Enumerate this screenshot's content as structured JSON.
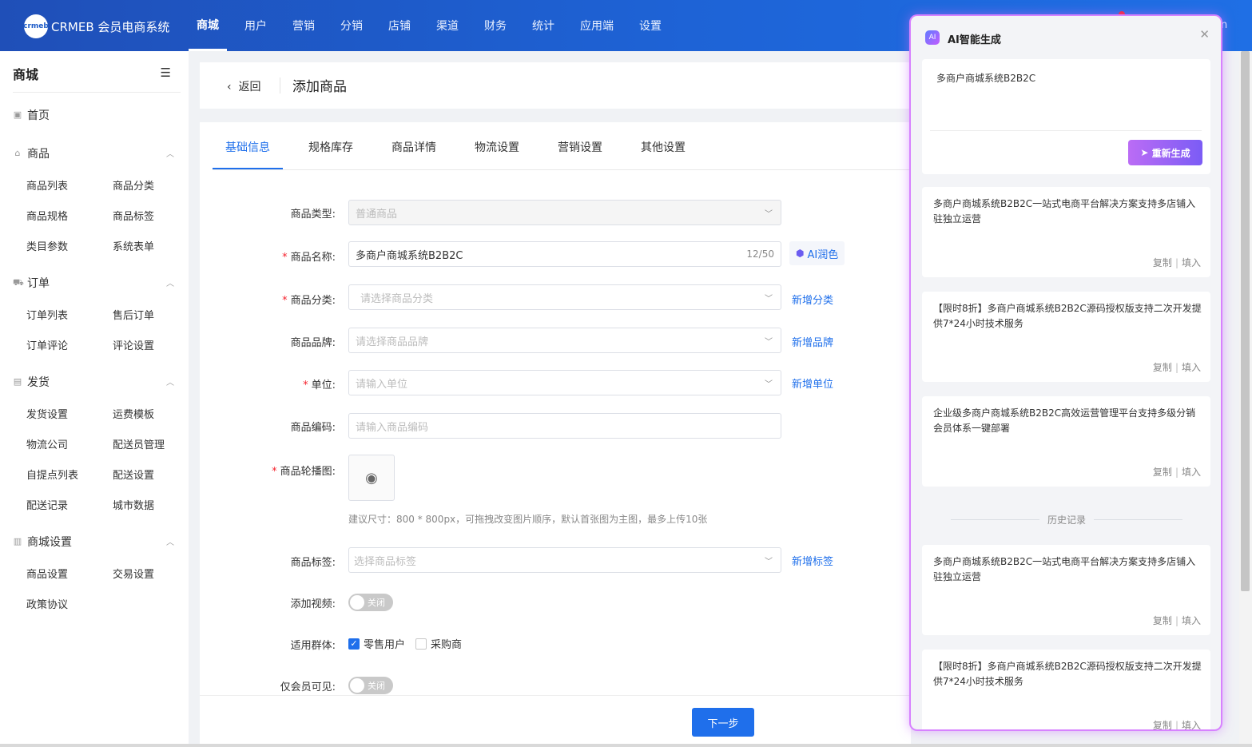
{
  "brand": {
    "logo_badge": "crmeb",
    "name": "CRMEB 会员电商系统"
  },
  "topnav": [
    "商城",
    "用户",
    "营销",
    "分销",
    "店铺",
    "渠道",
    "财务",
    "统计",
    "应用端",
    "设置"
  ],
  "topbar_user": "n",
  "sidebar": {
    "title": "商城",
    "home": "首页",
    "sections": [
      {
        "label": "商品",
        "items": [
          "商品列表",
          "商品分类",
          "商品规格",
          "商品标签",
          "类目参数",
          "系统表单"
        ]
      },
      {
        "label": "订单",
        "items": [
          "订单列表",
          "售后订单",
          "订单评论",
          "评论设置"
        ]
      },
      {
        "label": "发货",
        "items": [
          "发货设置",
          "运费模板",
          "物流公司",
          "配送员管理",
          "自提点列表",
          "配送设置",
          "配送记录",
          "城市数据"
        ]
      },
      {
        "label": "商城设置",
        "items": [
          "商品设置",
          "交易设置",
          "政策协议"
        ]
      }
    ]
  },
  "header": {
    "back": "返回",
    "title": "添加商品"
  },
  "tabs": [
    "基础信息",
    "规格库存",
    "商品详情",
    "物流设置",
    "营销设置",
    "其他设置"
  ],
  "form": {
    "type_label": "商品类型:",
    "type_value": "普通商品",
    "name_label": "商品名称:",
    "name_value": "多商户商城系统B2B2C",
    "name_count": "12/50",
    "ai_polish": "AI润色",
    "category_label": "商品分类:",
    "category_ph": "请选择商品分类",
    "category_link": "新增分类",
    "brand_label": "商品品牌:",
    "brand_ph": "请选择商品品牌",
    "brand_link": "新增品牌",
    "unit_label": "单位:",
    "unit_ph": "请输入单位",
    "unit_link": "新增单位",
    "code_label": "商品编码:",
    "code_ph": "请输入商品编码",
    "carousel_label": "商品轮播图:",
    "carousel_hint": "建议尺寸：800 * 800px，可拖拽改变图片顺序，默认首张图为主图，最多上传10张",
    "tag_label": "商品标签:",
    "tag_ph": "选择商品标签",
    "tag_link": "新增标签",
    "video_label": "添加视频:",
    "video_state": "关闭",
    "audience_label": "适用群体:",
    "audience_opt1": "零售用户",
    "audience_opt2": "采购商",
    "member_label": "仅会员可见:",
    "member_state": "关闭"
  },
  "footer": {
    "next": "下一步"
  },
  "ai_panel": {
    "title": "AI智能生成",
    "prompt": "多商户商城系统B2B2C",
    "regen": "重新生成",
    "copy": "复制",
    "sep": "|",
    "fill": "填入",
    "history_label": "历史记录",
    "results": [
      "多商户商城系统B2B2C一站式电商平台解决方案支持多店铺入驻独立运营",
      "【限时8折】多商户商城系统B2B2C源码授权版支持二次开发提供7*24小时技术服务",
      "企业级多商户商城系统B2B2C高效运营管理平台支持多级分销会员体系一键部署"
    ],
    "history": [
      "多商户商城系统B2B2C一站式电商平台解决方案支持多店铺入驻独立运营",
      "【限时8折】多商户商城系统B2B2C源码授权版支持二次开发提供7*24小时技术服务"
    ]
  },
  "colors": {
    "primary": "#1f6feb",
    "topbar": "#1e5cc8",
    "ai_accent": "#b86cf5",
    "required": "#f5222d"
  }
}
